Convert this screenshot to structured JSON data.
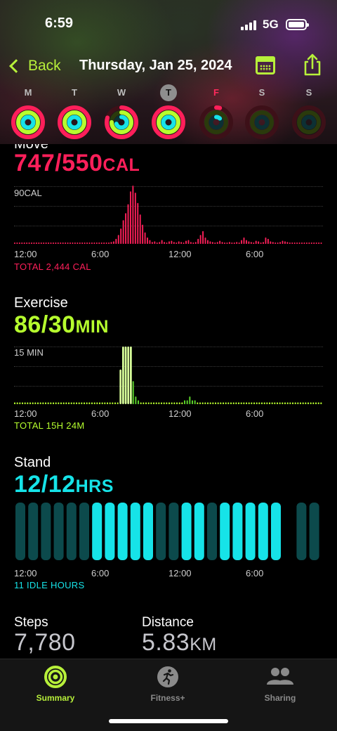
{
  "status": {
    "time": "6:59",
    "network": "5G"
  },
  "nav": {
    "back_label": "Back",
    "title": "Thursday, Jan 25, 2024"
  },
  "week": [
    {
      "letter": "M",
      "move": 1.0,
      "exercise": 1.0,
      "stand": 1.0
    },
    {
      "letter": "T",
      "move": 1.0,
      "exercise": 1.0,
      "stand": 1.0
    },
    {
      "letter": "W",
      "move": 0.8,
      "exercise": 0.75,
      "stand": 0.7
    },
    {
      "letter": "T",
      "move": 1.0,
      "exercise": 1.0,
      "stand": 1.0,
      "today": true
    },
    {
      "letter": "F",
      "move": 0.04,
      "exercise": 0.0,
      "stand": 0.12,
      "highlight": true
    },
    {
      "letter": "S",
      "move": 0,
      "exercise": 0,
      "stand": 0
    },
    {
      "letter": "S",
      "move": 0,
      "exercise": 0,
      "stand": 0
    }
  ],
  "move": {
    "title": "Move",
    "value": "747/550",
    "unit": "CAL",
    "scale_label": "90CAL",
    "total": "TOTAL 2,444 CAL",
    "color": "#ff1f5a",
    "ticks": [
      "12:00",
      "6:00",
      "12:00",
      "6:00"
    ],
    "bars": [
      2,
      2,
      2,
      2,
      2,
      2,
      2,
      2,
      2,
      2,
      2,
      2,
      2,
      2,
      2,
      2,
      2,
      2,
      2,
      2,
      2,
      2,
      2,
      2,
      2,
      2,
      2,
      2,
      2,
      2,
      2,
      2,
      2,
      2,
      2,
      2,
      2,
      2,
      2,
      2,
      3,
      4,
      8,
      14,
      24,
      37,
      48,
      62,
      82,
      91,
      80,
      64,
      46,
      30,
      18,
      10,
      6,
      3,
      4,
      2,
      3,
      6,
      3,
      2,
      4,
      5,
      3,
      2,
      4,
      3,
      2,
      5,
      6,
      3,
      2,
      3,
      8,
      14,
      20,
      10,
      6,
      4,
      3,
      2,
      3,
      5,
      3,
      2,
      2,
      3,
      2,
      2,
      3,
      2,
      6,
      10,
      6,
      4,
      3,
      2,
      5,
      4,
      2,
      3,
      10,
      8,
      4,
      3,
      2,
      2,
      3,
      5,
      4,
      3,
      2,
      2,
      2,
      2,
      2,
      2,
      2,
      2,
      2,
      2,
      2,
      2,
      2,
      2
    ]
  },
  "exercise": {
    "title": "Exercise",
    "value": "86/30",
    "unit": "MIN",
    "scale_label": "15 MIN",
    "total": "TOTAL 15H 24M",
    "color": "#b6ff2e",
    "ticks": [
      "12:00",
      "6:00",
      "12:00",
      "6:00"
    ],
    "bars": [
      0,
      0,
      0,
      0,
      0,
      0,
      0,
      0,
      0,
      0,
      0,
      0,
      0,
      0,
      0,
      0,
      0,
      0,
      0,
      0,
      0,
      0,
      0,
      0,
      0,
      0,
      0,
      0,
      0,
      0,
      0,
      0,
      0,
      0,
      0,
      0,
      0,
      0,
      0,
      0,
      0,
      9,
      15,
      15,
      15,
      15,
      6,
      2,
      1,
      0,
      0,
      0,
      0,
      0,
      0,
      0,
      0,
      0,
      0,
      0,
      0,
      0,
      0,
      0,
      0,
      0,
      1,
      1,
      2,
      1,
      1,
      0,
      0,
      0,
      0,
      0,
      0,
      0,
      0,
      0,
      0,
      0,
      0,
      0,
      0,
      0,
      0,
      0,
      0,
      0,
      0,
      0,
      0,
      0,
      0,
      0,
      0,
      0,
      0,
      0,
      0,
      0,
      0,
      0,
      0,
      0,
      0,
      0,
      0,
      0,
      0,
      0,
      0,
      0,
      0,
      0,
      0,
      0,
      0,
      0
    ]
  },
  "stand": {
    "title": "Stand",
    "value": "12/12",
    "unit": "HRS",
    "total": "11 IDLE HOURS",
    "color": "#16e3e8",
    "ticks": [
      "12:00",
      "6:00",
      "12:00",
      "6:00"
    ],
    "hours": [
      0,
      0,
      0,
      0,
      0,
      0,
      1,
      1,
      1,
      1,
      1,
      0,
      0,
      1,
      1,
      0,
      1,
      1,
      1,
      1,
      1,
      2,
      0,
      0
    ]
  },
  "stats": {
    "steps_label": "Steps",
    "steps_value": "7,780",
    "distance_label": "Distance",
    "distance_value": "5.83",
    "distance_unit": "KM"
  },
  "tabs": [
    {
      "label": "Summary",
      "icon": "activity-rings-icon",
      "active": true
    },
    {
      "label": "Fitness+",
      "icon": "runner-icon",
      "active": false
    },
    {
      "label": "Sharing",
      "icon": "people-icon",
      "active": false
    }
  ],
  "colors": {
    "accent": "#b7f03a",
    "move": "#ff1f5a",
    "exercise": "#b6ff2e",
    "stand": "#16e3e8"
  }
}
